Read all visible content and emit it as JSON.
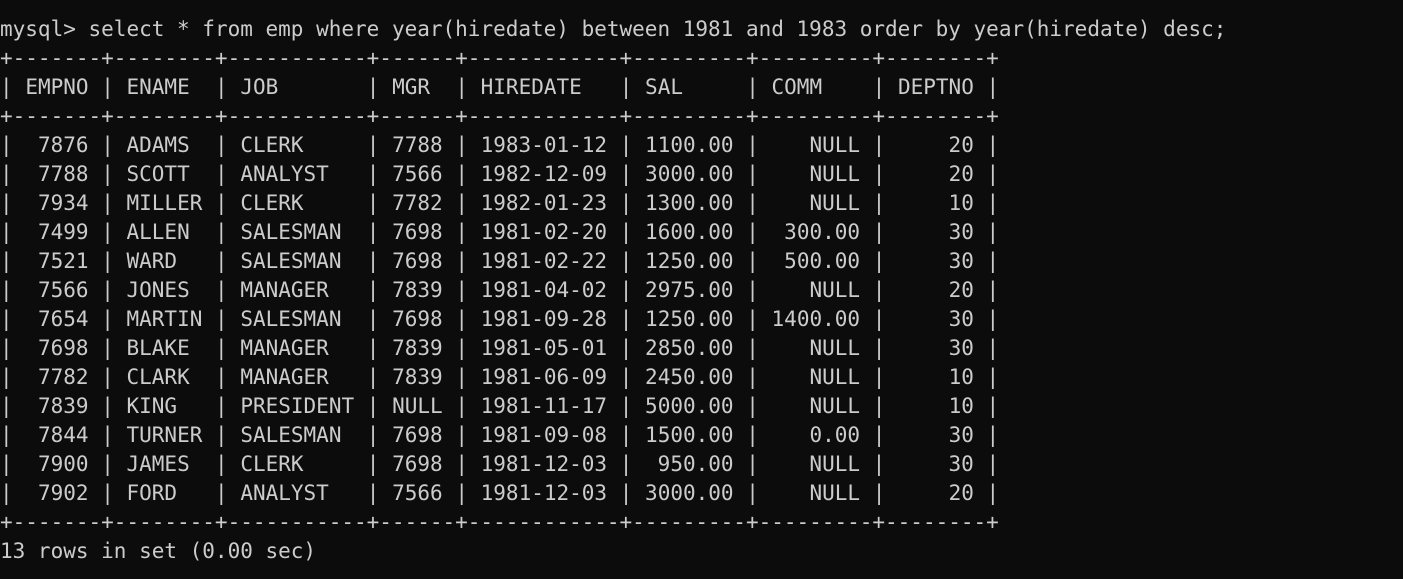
{
  "terminal": {
    "prompt": "mysql> ",
    "command": "select * from emp where year(hiredate) between 1981 and 1983 order by year(hiredate) desc;",
    "columns": [
      "EMPNO",
      "ENAME",
      "JOB",
      "MGR",
      "HIREDATE",
      "SAL",
      "COMM",
      "DEPTNO"
    ],
    "rows": [
      [
        "7876",
        "ADAMS",
        "CLERK",
        "7788",
        "1983-01-12",
        "1100.00",
        "NULL",
        "20"
      ],
      [
        "7788",
        "SCOTT",
        "ANALYST",
        "7566",
        "1982-12-09",
        "3000.00",
        "NULL",
        "20"
      ],
      [
        "7934",
        "MILLER",
        "CLERK",
        "7782",
        "1982-01-23",
        "1300.00",
        "NULL",
        "10"
      ],
      [
        "7499",
        "ALLEN",
        "SALESMAN",
        "7698",
        "1981-02-20",
        "1600.00",
        "300.00",
        "30"
      ],
      [
        "7521",
        "WARD",
        "SALESMAN",
        "7698",
        "1981-02-22",
        "1250.00",
        "500.00",
        "30"
      ],
      [
        "7566",
        "JONES",
        "MANAGER",
        "7839",
        "1981-04-02",
        "2975.00",
        "NULL",
        "20"
      ],
      [
        "7654",
        "MARTIN",
        "SALESMAN",
        "7698",
        "1981-09-28",
        "1250.00",
        "1400.00",
        "30"
      ],
      [
        "7698",
        "BLAKE",
        "MANAGER",
        "7839",
        "1981-05-01",
        "2850.00",
        "NULL",
        "30"
      ],
      [
        "7782",
        "CLARK",
        "MANAGER",
        "7839",
        "1981-06-09",
        "2450.00",
        "NULL",
        "10"
      ],
      [
        "7839",
        "KING",
        "PRESIDENT",
        "NULL",
        "1981-11-17",
        "5000.00",
        "NULL",
        "10"
      ],
      [
        "7844",
        "TURNER",
        "SALESMAN",
        "7698",
        "1981-09-08",
        "1500.00",
        "0.00",
        "30"
      ],
      [
        "7900",
        "JAMES",
        "CLERK",
        "7698",
        "1981-12-03",
        "950.00",
        "NULL",
        "30"
      ],
      [
        "7902",
        "FORD",
        "ANALYST",
        "7566",
        "1981-12-03",
        "3000.00",
        "NULL",
        "20"
      ]
    ],
    "footer": "13 rows in set (0.00 sec)"
  },
  "colors": {
    "background": "#0c0c0c",
    "foreground": "#cccccc"
  }
}
